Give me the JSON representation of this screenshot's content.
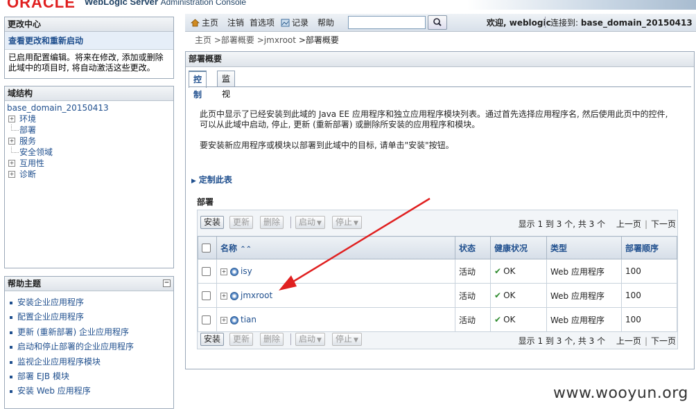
{
  "banner": {
    "logo": "ORACLE",
    "product": "WebLogic Server",
    "product_sub": "Administration Console"
  },
  "change_center": {
    "title": "更改中心",
    "link": "查看更改和重新启动",
    "text": "已启用配置编辑。将来在修改, 添加或删除此域中的项目时, 将自动激活这些更改。"
  },
  "domain_structure": {
    "title": "域结构",
    "root": "base_domain_20150413",
    "items": [
      {
        "label": "环境",
        "expandable": true
      },
      {
        "label": "部署",
        "expandable": false
      },
      {
        "label": "服务",
        "expandable": true
      },
      {
        "label": "安全领域",
        "expandable": false
      },
      {
        "label": "互用性",
        "expandable": true
      },
      {
        "label": "诊断",
        "expandable": true
      }
    ]
  },
  "help": {
    "title": "帮助主题",
    "items": [
      "安装企业应用程序",
      "配置企业应用程序",
      "更新 (重新部署) 企业应用程序",
      "启动和停止部署的企业应用程序",
      "监视企业应用程序模块",
      "部署 EJB 模块",
      "安装 Web 应用程序"
    ]
  },
  "toolbar": {
    "home": "主页",
    "logout": "注销",
    "preferences": "首选项",
    "record": "记录",
    "help": "帮助",
    "search_value": "",
    "welcome": "欢迎, weblogic",
    "connected_label": "连接到:",
    "connected_domain": "base_domain_20150413"
  },
  "breadcrumb": {
    "items": [
      "主页",
      ">部署概要",
      ">jmxroot",
      ">部署概要"
    ]
  },
  "main": {
    "title": "部署概要",
    "tabs": [
      "控制",
      "监视"
    ],
    "intro_1": "此页中显示了已经安装到此域的 Java EE 应用程序和独立应用程序模块列表。通过首先选择应用程序名, 然后使用此页中的控件, 可以从此域中启动, 停止, 更新 (重新部署) 或删除所安装的应用程序和模块。",
    "intro_2": "要安装新应用程序或模块以部署到此域中的目标, 请单击\"安装\"按钮。",
    "customize": "定制此表",
    "section_title": "部署",
    "buttons": {
      "install": "安装",
      "update": "更新",
      "delete": "删除",
      "start": "启动",
      "stop": "停止"
    },
    "pager": {
      "summary": "显示 1 到 3 个, 共 3 个",
      "prev": "上一页",
      "next": "下一页"
    },
    "table": {
      "columns": [
        "名称",
        "状态",
        "健康状况",
        "类型",
        "部署顺序"
      ],
      "rows": [
        {
          "name": "isy",
          "state": "活动",
          "health": "OK",
          "type": "Web 应用程序",
          "order": "100"
        },
        {
          "name": "jmxroot",
          "state": "活动",
          "health": "OK",
          "type": "Web 应用程序",
          "order": "100"
        },
        {
          "name": "tian",
          "state": "活动",
          "health": "OK",
          "type": "Web 应用程序",
          "order": "100"
        }
      ]
    }
  },
  "watermark": "www.wooyun.org",
  "colors": {
    "accent": "#1f4f8e",
    "arrow": "#e02020",
    "ok": "#2e8b2e"
  }
}
